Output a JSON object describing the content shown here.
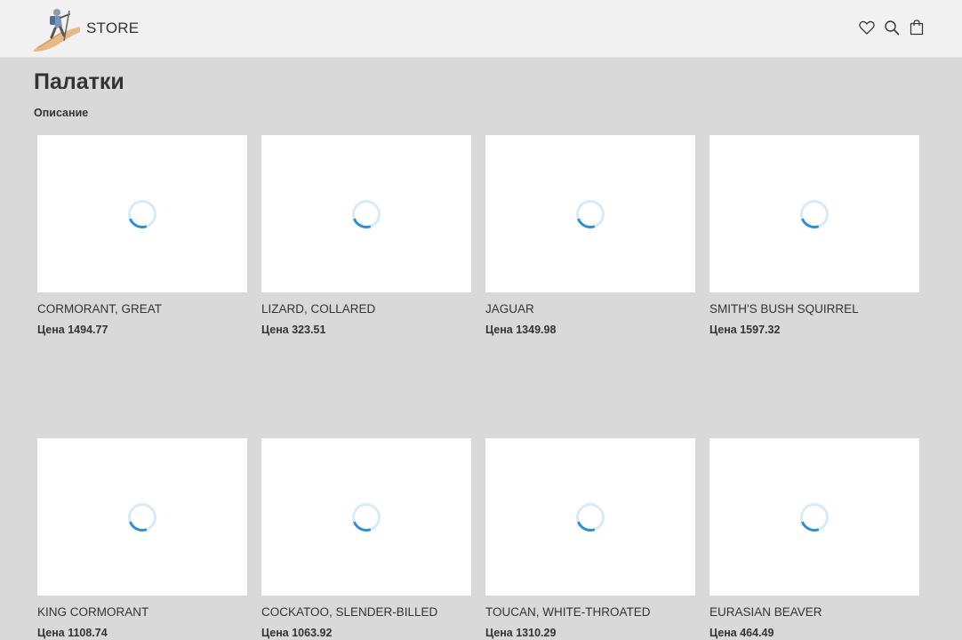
{
  "header": {
    "brand": "STORE",
    "icons": [
      "heart-icon",
      "search-icon",
      "shopping-bag-icon"
    ]
  },
  "category": {
    "title": "Палатки",
    "description": "Описание"
  },
  "products": [
    {
      "name": "CORMORANT, GREAT",
      "price": "Цена 1494.77"
    },
    {
      "name": "LIZARD, COLLARED",
      "price": "Цена 323.51"
    },
    {
      "name": "JAGUAR",
      "price": "Цена 1349.98"
    },
    {
      "name": "SMITH'S BUSH SQUIRREL",
      "price": "Цена 1597.32"
    },
    {
      "name": "KING CORMORANT",
      "price": "Цена 1108.74"
    },
    {
      "name": "COCKATOO, SLENDER-BILLED",
      "price": "Цена 1063.92"
    },
    {
      "name": "TOUCAN, WHITE-THROATED",
      "price": "Цена 1310.29"
    },
    {
      "name": "EURASIAN BEAVER",
      "price": "Цена 464.49"
    }
  ],
  "colors": {
    "background": "#d9d9d9",
    "header": "#f1f1f1",
    "spinner_track": "#d6ebfa",
    "spinner_arc": "#2a8fd8"
  }
}
